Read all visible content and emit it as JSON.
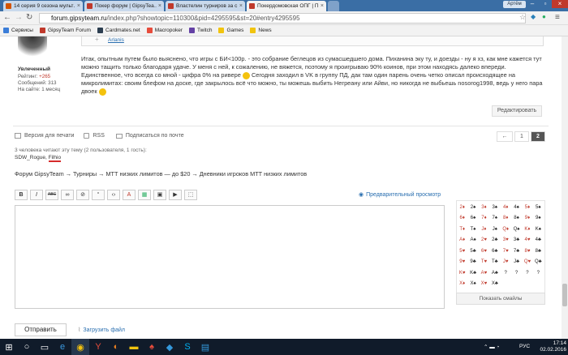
{
  "browser": {
    "tabs": [
      {
        "title": "14 серия 9 сезона мульт…",
        "color": "#d35400"
      },
      {
        "title": "Покер форум | GipsyTea…",
        "color": "#c0392b"
      },
      {
        "title": "Властелин турниров за с…",
        "color": "#c0392b"
      },
      {
        "title": "Покердомовская ОПГ | П…",
        "color": "#c0392b"
      }
    ],
    "user_chip": "Артём",
    "url_domain": "forum.gipsyteam.ru",
    "url_path": "/index.php?showtopic=110300&pid=4295595&st=20#entry4295595"
  },
  "bookmarks": [
    {
      "label": "Сервисы",
      "color": "#3b7dd8"
    },
    {
      "label": "GipsyTeam Forum",
      "color": "#c0392b"
    },
    {
      "label": "Cardmates.net",
      "color": "#2c3e50"
    },
    {
      "label": "Macropoker",
      "color": "#e74c3c"
    },
    {
      "label": "Twitch",
      "color": "#6441a5"
    },
    {
      "label": "Games",
      "color": "#f1c40f"
    },
    {
      "label": "News",
      "color": "#f1c40f"
    }
  ],
  "post": {
    "quote_author": "Arlanis",
    "user_rank": "Увлеченный",
    "rating_label": "Рейтинг:",
    "rating_value": "+265",
    "messages_label": "Сообщений:",
    "messages_value": "313",
    "onsite": "На сайте: 1 месяц",
    "paragraph1": "Итак, опытным путем было выяснено, что игры с БИ<100р. - это собрание беглецов из сумасшедшего дома. Пиханина эку ту, и доезды - ну я хз, как мне кажется тут можно тащить только благодаря удаче. У меня с ней, к сожалению, не вяжется, поэтому я проигрываю 90% коинов, при этом находясь далеко впереди. Единственное, что всегда со мной - цифра 0% на ривере",
    "paragraph2": " Сегодня заходил в VK в группу ПД, дак там один парень очень четко описал происходящее на микролимитах: своим блефом на доске, где закрылось всё что можно, ты можешь выбить Негреану или Айви, но никогда не выбьешь nosorog1998, ведь у него пара двоек",
    "edit_label": "Редактировать"
  },
  "topic": {
    "print_label": "Версия для печати",
    "rss_label": "RSS",
    "subscribe_label": "Подписаться по почте",
    "pages": [
      "←",
      "1",
      "2"
    ],
    "readers_text": "3 человека читают эту тему (2 пользователя, 1 гость):",
    "reader1": "SDW_Rogue",
    "reader2": "Filhio",
    "breadcrumb": "Форум GipsyTeam → Турниры → МТТ низких лимитов — до $20 → Дневники игроков МТТ низких лимитов"
  },
  "editor": {
    "tools": [
      "B",
      "I",
      "ABC",
      "∞",
      "⊘",
      "“",
      "‹›",
      "A",
      "▦",
      "▣",
      "▶",
      "⬚"
    ],
    "preview_label": "Предварительный просмотр",
    "show_smilies": "Показать смайлы",
    "submit_label": "Отправить",
    "upload_label": "Загрузить файл"
  },
  "smilies": [
    [
      "2♦",
      "2♠",
      "3♦",
      "3♠",
      "4♦",
      "4♠",
      "5♦",
      "5♠"
    ],
    [
      "6♦",
      "6♠",
      "7♦",
      "7♠",
      "8♦",
      "8♠",
      "9♦",
      "9♠"
    ],
    [
      "T♦",
      "T♠",
      "J♦",
      "J♠",
      "Q♦",
      "Q♠",
      "K♦",
      "K♠"
    ],
    [
      "A♦",
      "A♠",
      "2♥",
      "2♣",
      "3♥",
      "3♣",
      "4♥",
      "4♣"
    ],
    [
      "5♥",
      "5♣",
      "6♥",
      "6♣",
      "7♥",
      "7♣",
      "8♥",
      "8♣"
    ],
    [
      "9♥",
      "9♣",
      "T♥",
      "T♣",
      "J♥",
      "J♣",
      "Q♥",
      "Q♣"
    ],
    [
      "K♥",
      "K♣",
      "A♥",
      "A♣",
      "?",
      "?",
      "?",
      "?"
    ],
    [
      "X♦",
      "X♠",
      "X♥",
      "X♣",
      "",
      "",
      "",
      ""
    ]
  ],
  "taskbar": {
    "time": "17:14",
    "date": "02.02.2016",
    "lang": "РУС"
  }
}
